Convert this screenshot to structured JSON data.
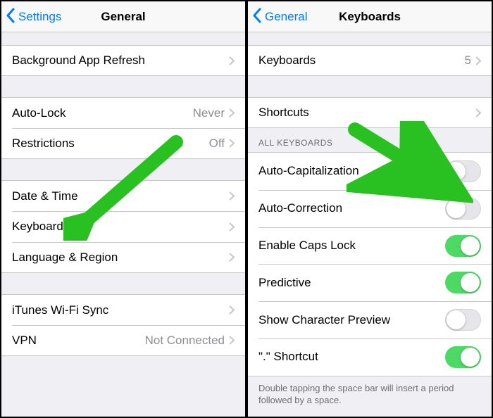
{
  "left": {
    "back_label": "Settings",
    "title": "General",
    "groups": [
      {
        "rows": [
          {
            "label": "Background App Refresh"
          }
        ]
      },
      {
        "rows": [
          {
            "label": "Auto-Lock",
            "detail": "Never"
          },
          {
            "label": "Restrictions",
            "detail": "Off"
          }
        ]
      },
      {
        "rows": [
          {
            "label": "Date & Time"
          },
          {
            "label": "Keyboard"
          },
          {
            "label": "Language & Region"
          }
        ]
      },
      {
        "rows": [
          {
            "label": "iTunes Wi-Fi Sync"
          },
          {
            "label": "VPN",
            "detail": "Not Connected"
          }
        ]
      }
    ]
  },
  "right": {
    "back_label": "General",
    "title": "Keyboards",
    "groups": [
      {
        "rows": [
          {
            "label": "Keyboards",
            "detail": "5"
          }
        ]
      },
      {
        "rows": [
          {
            "label": "Shortcuts"
          }
        ]
      },
      {
        "header": "ALL KEYBOARDS",
        "rows": [
          {
            "label": "Auto-Capitalization",
            "toggle": false
          },
          {
            "label": "Auto-Correction",
            "toggle": false
          },
          {
            "label": "Enable Caps Lock",
            "toggle": true
          },
          {
            "label": "Predictive",
            "toggle": true
          },
          {
            "label": "Show Character Preview",
            "toggle": false
          },
          {
            "label": "\".\" Shortcut",
            "toggle": true
          }
        ],
        "footer": "Double tapping the space bar will insert a period followed by a space."
      }
    ]
  }
}
